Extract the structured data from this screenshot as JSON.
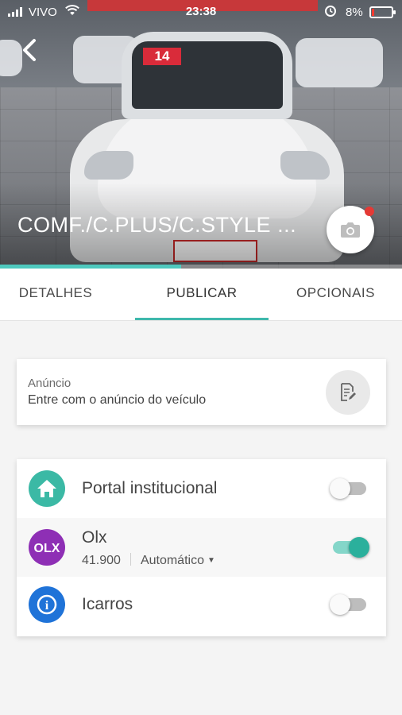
{
  "status_bar": {
    "carrier": "VIVO",
    "time": "23:38",
    "battery": "8%"
  },
  "hero": {
    "title": "COMF./C.PLUS/C.STYLE ...",
    "car_tag": "14",
    "photo_progress": 0.45
  },
  "tabs": [
    {
      "label": "DETALHES",
      "selected": false
    },
    {
      "label": "PUBLICAR",
      "selected": true
    },
    {
      "label": "OPCIONAIS",
      "selected": false
    }
  ],
  "anuncio": {
    "label": "Anúncio",
    "placeholder": "Entre com o anúncio do veículo"
  },
  "portals": [
    {
      "name": "Portal institucional",
      "icon": "home-icon",
      "color": "#3bb9a5",
      "enabled": false
    },
    {
      "name": "Olx",
      "icon": "olx-logo",
      "color": "#8e2fb5",
      "enabled": true,
      "price": "41.900",
      "mode": "Automático"
    },
    {
      "name": "Icarros",
      "icon": "icarros-logo",
      "color": "#1f73d8",
      "enabled": false
    }
  ],
  "colors": {
    "accent": "#3fb8ac",
    "toggle_on": "#2bb09c",
    "notification": "#e53935"
  }
}
